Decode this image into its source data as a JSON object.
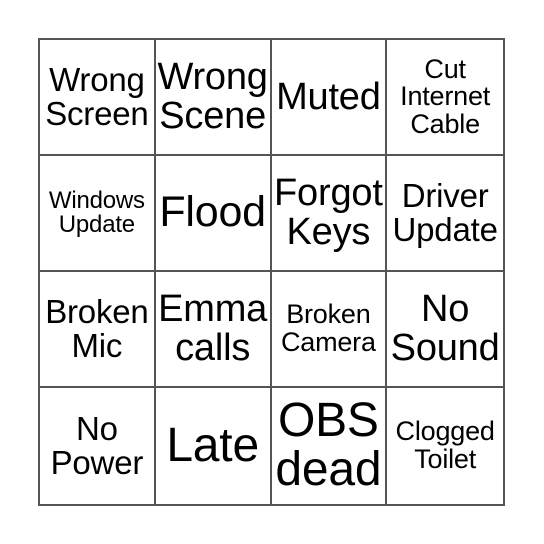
{
  "card": {
    "type": "bingo-card",
    "rows": 4,
    "columns": 4,
    "text_color": "#000000",
    "grid_line_color": "#555555",
    "background_color": "#ffffff",
    "cells": [
      {
        "text": "Wrong\nScreen",
        "size": "md"
      },
      {
        "text": "Wrong\nScene",
        "size": "lg"
      },
      {
        "text": "Muted",
        "size": "lg"
      },
      {
        "text": "Cut\nInternet\nCable",
        "size": "sm"
      },
      {
        "text": "Windows\nUpdate",
        "size": "xs"
      },
      {
        "text": "Flood",
        "size": "xl"
      },
      {
        "text": "Forgot\nKeys",
        "size": "lg"
      },
      {
        "text": "Driver\nUpdate",
        "size": "md"
      },
      {
        "text": "Broken\nMic",
        "size": "md"
      },
      {
        "text": "Emma\ncalls",
        "size": "lg"
      },
      {
        "text": "Broken\nCamera",
        "size": "sm"
      },
      {
        "text": "No\nSound",
        "size": "lg"
      },
      {
        "text": "No\nPower",
        "size": "md"
      },
      {
        "text": "Late",
        "size": "xxl"
      },
      {
        "text": "OBS\ndead",
        "size": "xxl"
      },
      {
        "text": "Clogged\nToilet",
        "size": "sm"
      }
    ]
  }
}
